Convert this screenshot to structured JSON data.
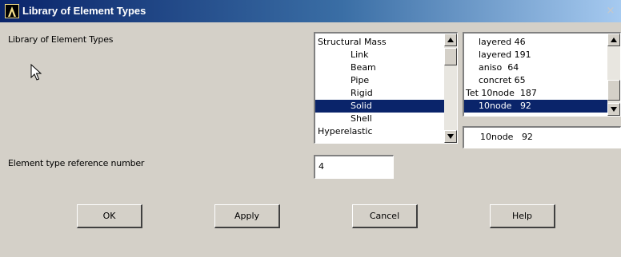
{
  "window": {
    "title": "Library of Element Types",
    "close_glyph": "×"
  },
  "labels": {
    "library": "Library of Element Types",
    "ref_number": "Element type reference number"
  },
  "category_list": {
    "items": [
      {
        "label": "Structural Mass",
        "indent": false
      },
      {
        "label": "Link",
        "indent": true
      },
      {
        "label": "Beam",
        "indent": true
      },
      {
        "label": "Pipe",
        "indent": true
      },
      {
        "label": "Rigid",
        "indent": true
      },
      {
        "label": "Solid",
        "indent": true,
        "selected": true
      },
      {
        "label": "Shell",
        "indent": true
      },
      {
        "label": "Hyperelastic",
        "indent": false
      }
    ]
  },
  "type_list": {
    "items": [
      {
        "label": "layered 46",
        "indent": true
      },
      {
        "label": "layered 191",
        "indent": true
      },
      {
        "label": "aniso  64",
        "indent": true
      },
      {
        "label": "concret 65",
        "indent": true
      },
      {
        "label": "Tet 10node  187",
        "indent": false
      },
      {
        "label": "10node   92",
        "indent": true,
        "selected": true
      }
    ]
  },
  "selected_type_display": "10node   92",
  "ref_number_value": "4",
  "buttons": {
    "ok": "OK",
    "apply": "Apply",
    "cancel": "Cancel",
    "help": "Help"
  },
  "icons": {
    "logo": "ansys-logo-icon",
    "cursor": "arrow-cursor-icon",
    "close": "close-icon"
  },
  "colors": {
    "title_start": "#0a246a",
    "title_end": "#a6caf0",
    "selection": "#0a246a",
    "face": "#d4d0c8"
  }
}
